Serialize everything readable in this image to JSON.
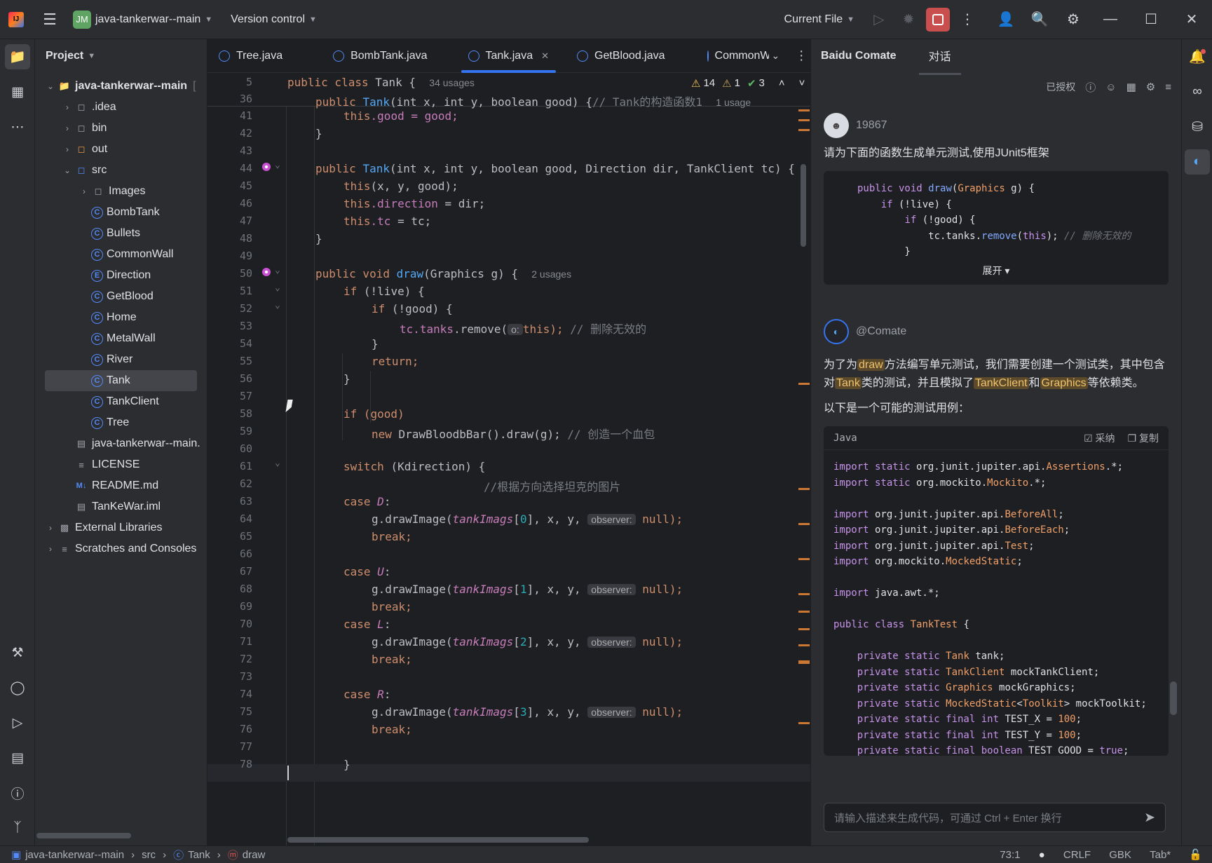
{
  "titlebar": {
    "app_initials": "JM",
    "project": "java-tankerwar--main",
    "vcs": "Version control",
    "run_config": "Current File"
  },
  "project_panel": {
    "title": "Project",
    "root": "java-tankerwar--main",
    "root_suffix": "[",
    "items": [
      {
        "label": ".idea",
        "type": "folder"
      },
      {
        "label": "bin",
        "type": "folder"
      },
      {
        "label": "out",
        "type": "folder"
      },
      {
        "label": "src",
        "type": "folder"
      },
      {
        "label": "Images",
        "type": "folder"
      },
      {
        "label": "BombTank",
        "type": "class"
      },
      {
        "label": "Bullets",
        "type": "class"
      },
      {
        "label": "CommonWall",
        "type": "class"
      },
      {
        "label": "Direction",
        "type": "enum"
      },
      {
        "label": "GetBlood",
        "type": "class"
      },
      {
        "label": "Home",
        "type": "class"
      },
      {
        "label": "MetalWall",
        "type": "class"
      },
      {
        "label": "River",
        "type": "class"
      },
      {
        "label": "Tank",
        "type": "class"
      },
      {
        "label": "TankClient",
        "type": "class"
      },
      {
        "label": "Tree",
        "type": "class"
      },
      {
        "label": "java-tankerwar--main.",
        "type": "file"
      },
      {
        "label": "LICENSE",
        "type": "file"
      },
      {
        "label": "README.md",
        "type": "md"
      },
      {
        "label": "TanKeWar.iml",
        "type": "file"
      },
      {
        "label": "External Libraries",
        "type": "lib"
      },
      {
        "label": "Scratches and Consoles",
        "type": "scratch"
      }
    ]
  },
  "tabs": [
    "Tree.java",
    "BombTank.java",
    "Tank.java",
    "GetBlood.java",
    "CommonW"
  ],
  "editor": {
    "inspections": {
      "warnings": "14",
      "weak": "1",
      "ok": "3"
    },
    "sticky1_ln": "5",
    "sticky1_a": "public class ",
    "sticky1_b": "Tank",
    "sticky1_c": " {",
    "sticky1_hint": "34 usages",
    "sticky2_ln": "36",
    "sticky2_a": "public ",
    "sticky2_b": "Tank",
    "sticky2_c": "(int x, int y, boolean good) {",
    "sticky2_cm": "// Tank的构造函数1",
    "sticky2_hint": "1 usage",
    "line_numbers": [
      "41",
      "42",
      "43",
      "44",
      "45",
      "46",
      "47",
      "48",
      "49",
      "50",
      "51",
      "52",
      "53",
      "54",
      "55",
      "56",
      "57",
      "58",
      "59",
      "60",
      "61",
      "62",
      "63",
      "64",
      "65",
      "66",
      "67",
      "68",
      "69",
      "70",
      "71",
      "72",
      "73",
      "74",
      "75",
      "76",
      "77",
      "78"
    ],
    "t": {
      "this": "this",
      "good_assign": "good = good;",
      "brace": "}",
      "public": "public ",
      "tank": "Tank",
      "ctor_args": "(int x, int y, boolean good, Direction dir, TankClient tc) {",
      "call_xy": "(x, y, good);",
      "dir": ".direction",
      "dir_assign": " = dir;",
      "tc": ".tc",
      "tc_assign": " = tc;",
      "void": "public void ",
      "draw": "draw",
      "draw_args": "(Graphics g) {",
      "draw_hint": "2 usages",
      "if": "if ",
      "notlive": "(!live) {",
      "notgood": "(!good) {",
      "tc_var": "tc",
      "tanks": ".tanks",
      "remove": ".remove(",
      "o_hint": "o:",
      "this_end": "this);",
      "cm_remove": " // 删除无效的",
      "return": "return;",
      "ifgood": "if (good)",
      "new": "new ",
      "drawblood": "DrawBloodbBar().draw(g);",
      "cm_blood": " // 创造一个血包",
      "switch": "switch ",
      "kdir": "(Kdirection) {",
      "cm_dir": "//根据方向选择坦克的图片",
      "case": "case ",
      "D": "D",
      "U": "U",
      "L": "L",
      "R": "R",
      "colon": ":",
      "gdraw": "g.drawImage(",
      "imgs": "tankImags",
      "i0": "0",
      "i1": "1",
      "i2": "2",
      "i3": "3",
      "xy": ", x, y,",
      "observer": "observer:",
      "null_end": " null);",
      "break": "break;"
    }
  },
  "comate": {
    "title": "Baidu Comate",
    "tab": "对话",
    "authorized": "已授权",
    "user_name": "19867",
    "user_msg": "请为下面的函数生成单元测试,使用JUnit5框架",
    "expand": "展开",
    "bot_name": "@Comate",
    "bot_p1_a": "为了为",
    "bot_p1_draw": "draw",
    "bot_p1_b": "方法编写单元测试，我们需要创建一个测试类，其中包含对",
    "bot_p1_tank": "Tank",
    "bot_p1_c": "类的测试，并且模拟了",
    "bot_p1_tc": "TankClient",
    "bot_p1_d": "和",
    "bot_p1_g": "Graphics",
    "bot_p1_e": "等依赖类。",
    "bot_p2": "以下是一个可能的测试用例：",
    "code_lang": "Java",
    "adopt": "采纳",
    "copy": "复制",
    "input_placeholder": "请输入描述来生成代码，可通过 Ctrl + Enter 换行"
  },
  "statusbar": {
    "crumbs": [
      "java-tankerwar--main",
      "src",
      "Tank",
      "draw"
    ],
    "position": "73:1",
    "line_sep": "CRLF",
    "encoding": "GBK",
    "indent": "Tab*"
  }
}
